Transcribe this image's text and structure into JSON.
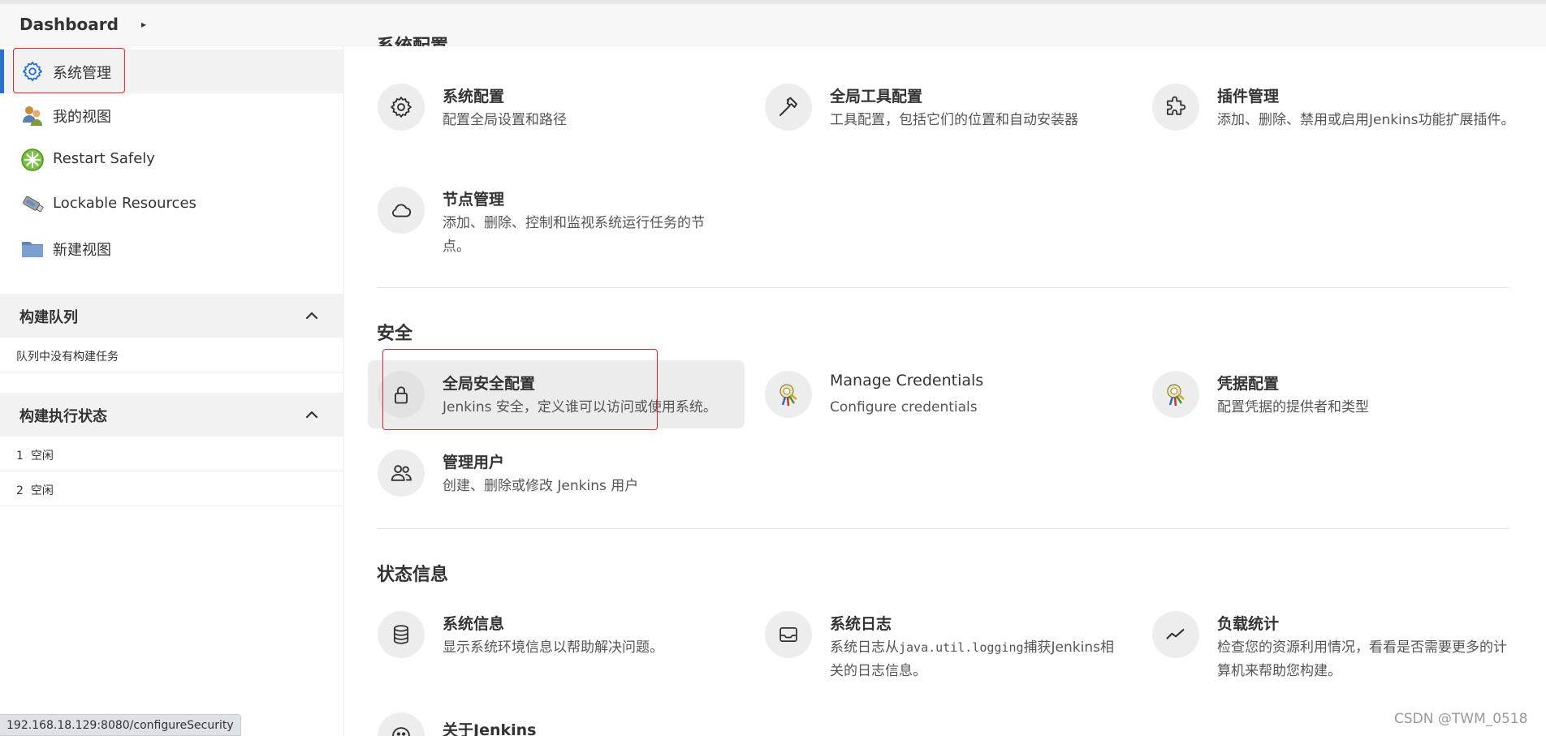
{
  "breadcrumb": {
    "root": "Dashboard",
    "separator": "▸"
  },
  "sidebar": {
    "items": [
      {
        "label": "系统管理",
        "icon": "gear-icon"
      },
      {
        "label": "我的视图",
        "icon": "people-view-icon"
      },
      {
        "label": "Restart Safely",
        "icon": "restart-icon"
      },
      {
        "label": "Lockable Resources",
        "icon": "usb-drive-icon"
      },
      {
        "label": "新建视图",
        "icon": "folder-icon"
      }
    ],
    "build_queue": {
      "title": "构建队列",
      "empty_text": "队列中没有构建任务"
    },
    "executor_status": {
      "title": "构建执行状态",
      "rows": [
        {
          "num": "1",
          "status": "空闲"
        },
        {
          "num": "2",
          "status": "空闲"
        }
      ]
    }
  },
  "sections": {
    "system": {
      "title": "系统配置",
      "cards": [
        {
          "title": "系统配置",
          "desc": "配置全局设置和路径",
          "icon": "gear-icon"
        },
        {
          "title": "全局工具配置",
          "desc": "工具配置，包括它们的位置和自动安装器",
          "icon": "hammer-icon"
        },
        {
          "title": "插件管理",
          "desc": "添加、删除、禁用或启用Jenkins功能扩展插件。",
          "icon": "puzzle-icon"
        },
        {
          "title": "节点管理",
          "desc": "添加、删除、控制和监视系统运行任务的节点。",
          "icon": "cloud-icon"
        }
      ]
    },
    "security": {
      "title": "安全",
      "cards": [
        {
          "title": "全局安全配置",
          "desc": "Jenkins 安全，定义谁可以访问或使用系统。",
          "icon": "lock-icon"
        },
        {
          "title": "Manage Credentials",
          "desc": "Configure credentials",
          "icon": "credentials-keys-icon"
        },
        {
          "title": "凭据配置",
          "desc": "配置凭据的提供者和类型",
          "icon": "credentials-keys-icon"
        },
        {
          "title": "管理用户",
          "desc": "创建、删除或修改 Jenkins 用户",
          "icon": "users-icon"
        }
      ]
    },
    "status": {
      "title": "状态信息",
      "cards": [
        {
          "title": "系统信息",
          "desc": "显示系统环境信息以帮助解决问题。",
          "icon": "database-icon"
        },
        {
          "title": "系统日志",
          "desc_prefix": "系统日志从",
          "desc_code": "java.util.logging",
          "desc_suffix": "捕获Jenkins相关的日志信息。",
          "icon": "inbox-icon"
        },
        {
          "title": "负载统计",
          "desc": "检查您的资源利用情况，看看是否需要更多的计算机来帮助您构建。",
          "icon": "trend-icon"
        },
        {
          "title": "关于Jenkins",
          "icon": "jenkins-logo-icon"
        }
      ]
    }
  },
  "status_bar": {
    "url": "192.168.18.129:8080/configureSecurity"
  },
  "watermark": "CSDN @TWM_0518",
  "colors": {
    "accent": "#2a6fcd",
    "highlight_border": "#e0262c"
  }
}
